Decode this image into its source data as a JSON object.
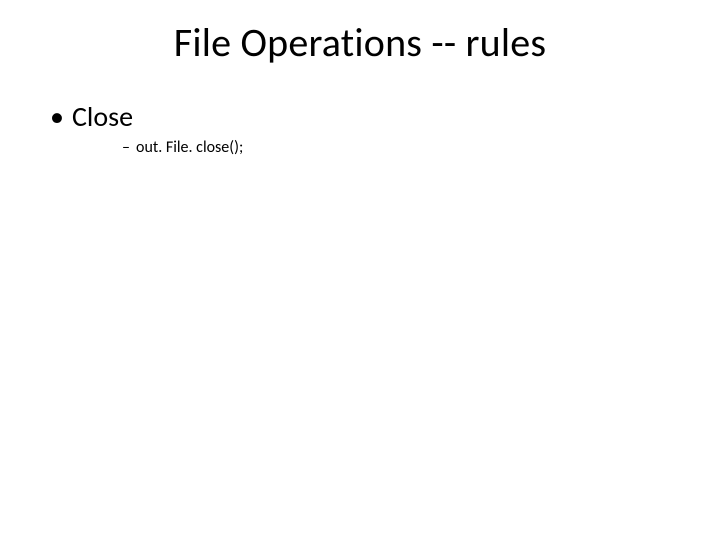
{
  "title": "File Operations -- rules",
  "bullets": {
    "lvl1": {
      "marker": "•",
      "text": "Close"
    },
    "lvl2": {
      "marker": "–",
      "text": "out. File. close();"
    }
  }
}
